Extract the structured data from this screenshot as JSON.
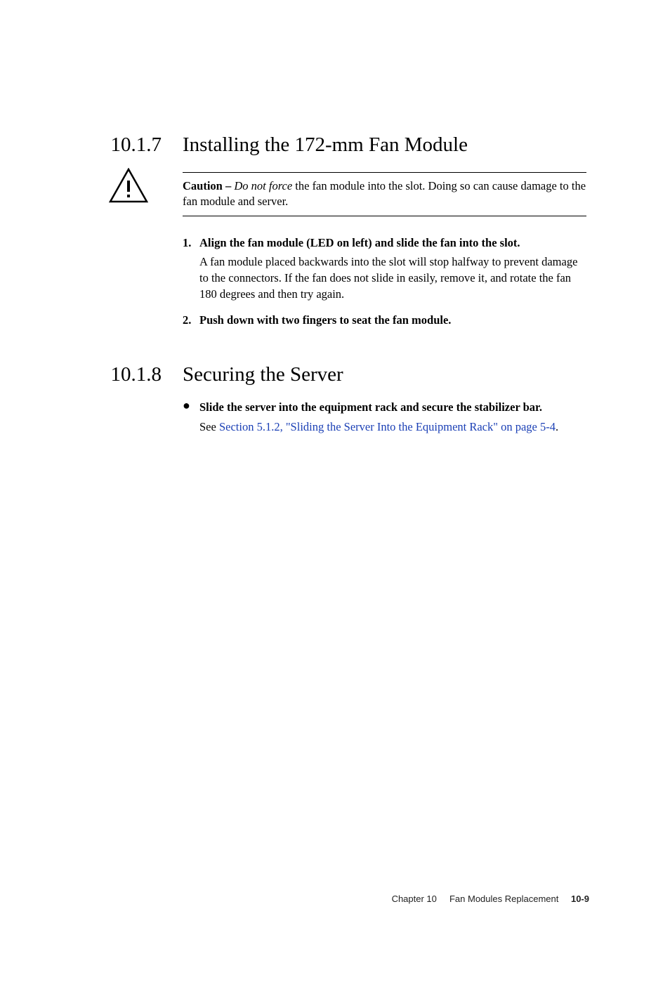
{
  "section1": {
    "num": "10.1.7",
    "title": "Installing the 172-mm Fan Module"
  },
  "caution": {
    "label": "Caution –",
    "italic": "Do not force",
    "rest": " the fan module into the slot. Doing so can cause damage to the fan module and server."
  },
  "steps": [
    {
      "num": "1.",
      "head": "Align the fan module (LED on left) and slide the fan into the slot.",
      "desc": "A fan module placed backwards into the slot will stop halfway to prevent damage to the connectors. If the fan does not slide in easily, remove it, and rotate the fan 180 degrees and then try again."
    },
    {
      "num": "2.",
      "head": "Push down with two fingers to seat the fan module.",
      "desc": ""
    }
  ],
  "section2": {
    "num": "10.1.8",
    "title": "Securing the Server"
  },
  "bullet": {
    "head": "Slide the server into the equipment rack and secure the stabilizer bar.",
    "see_prefix": "See ",
    "xref": "Section 5.1.2, \"Sliding the Server Into the Equipment Rack\" on page 5-4",
    "see_suffix": "."
  },
  "footer": {
    "chapter": "Chapter 10",
    "title": "Fan Modules Replacement",
    "page": "10-9"
  }
}
